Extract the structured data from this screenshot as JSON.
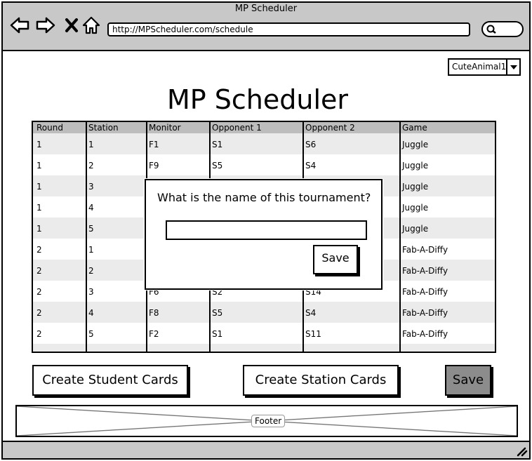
{
  "window": {
    "title": "MP Scheduler"
  },
  "browser": {
    "url": "http://MPScheduler.com/schedule"
  },
  "user_dropdown": {
    "value": "CuteAnimal1"
  },
  "page": {
    "title": "MP Scheduler"
  },
  "table": {
    "headers": [
      "Round",
      "Station",
      "Monitor",
      "Opponent 1",
      "Opponent 2",
      "Game"
    ],
    "rows": [
      [
        "1",
        "1",
        "F1",
        "S1",
        "S6",
        "Juggle"
      ],
      [
        "1",
        "2",
        "F9",
        "S5",
        "S4",
        "Juggle"
      ],
      [
        "1",
        "3",
        "",
        "",
        "",
        "Juggle"
      ],
      [
        "1",
        "4",
        "",
        "",
        "",
        "Juggle"
      ],
      [
        "1",
        "5",
        "",
        "",
        "",
        "Juggle"
      ],
      [
        "2",
        "1",
        "",
        "",
        "",
        "Fab-A-Diffy"
      ],
      [
        "2",
        "2",
        "",
        "",
        "",
        "Fab-A-Diffy"
      ],
      [
        "2",
        "3",
        "F6",
        "S2",
        "S14",
        "Fab-A-Diffy"
      ],
      [
        "2",
        "4",
        "F8",
        "S5",
        "S4",
        "Fab-A-Diffy"
      ],
      [
        "2",
        "5",
        "F2",
        "S1",
        "S11",
        "Fab-A-Diffy"
      ]
    ]
  },
  "modal": {
    "question": "What is the name of this tournament?",
    "input_value": "",
    "save_label": "Save"
  },
  "actions": {
    "student_cards_label": "Create Student Cards",
    "station_cards_label": "Create Station Cards",
    "save_label": "Save"
  },
  "footer": {
    "label": "Footer"
  },
  "icons": [
    "back-icon",
    "forward-icon",
    "close-icon",
    "home-icon",
    "search-icon",
    "resize-grip-icon",
    "chevron-down-icon"
  ],
  "colors": {
    "chrome": "#c8c8c8",
    "table_header": "#bdbdbd",
    "row_alt": "#ebebeb",
    "save_button": "#8c8c8c"
  }
}
